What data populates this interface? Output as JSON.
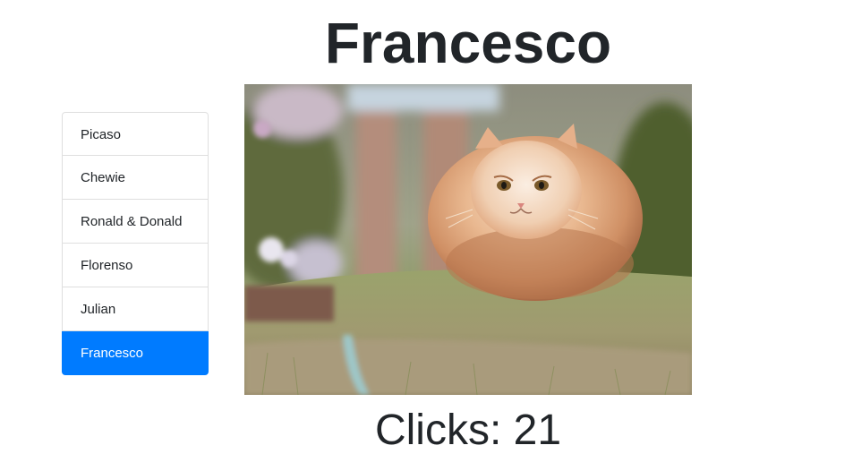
{
  "cats": [
    {
      "label": "Picaso"
    },
    {
      "label": "Chewie"
    },
    {
      "label": "Ronald & Donald"
    },
    {
      "label": "Florenso"
    },
    {
      "label": "Julian"
    },
    {
      "label": "Francesco",
      "active": true
    }
  ],
  "current": {
    "name": "Francesco",
    "clicks_text": "Clicks: 21",
    "clicks": 21
  },
  "colors": {
    "active_bg": "#007bff",
    "active_text": "#ffffff",
    "text": "#212529",
    "border": "#dfdfdf"
  }
}
